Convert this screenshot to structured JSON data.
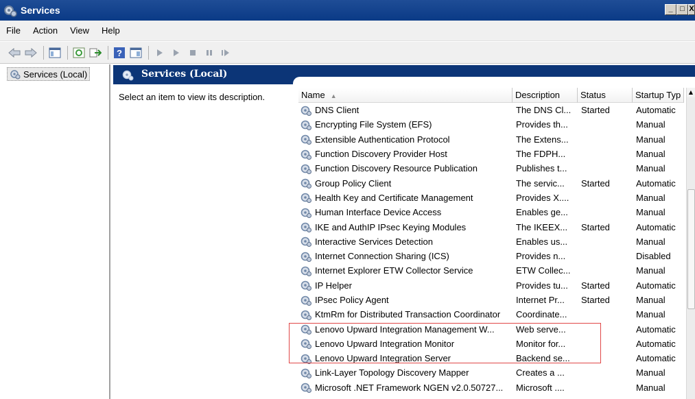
{
  "window": {
    "title": "Services"
  },
  "menu": {
    "items": [
      "File",
      "Action",
      "View",
      "Help"
    ]
  },
  "toolbar": {
    "icons": [
      "back-icon",
      "forward-icon",
      "console-tree-icon",
      "refresh-icon",
      "export-icon",
      "help-icon",
      "properties-icon",
      "start-service-icon",
      "start-icon-2",
      "stop-service-icon",
      "pause-service-icon",
      "restart-service-icon"
    ]
  },
  "tree": {
    "root_label": "Services (Local)"
  },
  "pane": {
    "header_title": "Services (Local)",
    "description_prompt": "Select an item to view its description."
  },
  "columns": {
    "name": "Name",
    "description": "Description",
    "status": "Status",
    "startup": "Startup Typ"
  },
  "services": [
    {
      "name": "DNS Client",
      "description": "The DNS Cl...",
      "status": "Started",
      "startup": "Automatic"
    },
    {
      "name": "Encrypting File System (EFS)",
      "description": "Provides th...",
      "status": "",
      "startup": "Manual"
    },
    {
      "name": "Extensible Authentication Protocol",
      "description": "The Extens...",
      "status": "",
      "startup": "Manual"
    },
    {
      "name": "Function Discovery Provider Host",
      "description": "The FDPH...",
      "status": "",
      "startup": "Manual"
    },
    {
      "name": "Function Discovery Resource Publication",
      "description": "Publishes t...",
      "status": "",
      "startup": "Manual"
    },
    {
      "name": "Group Policy Client",
      "description": "The servic...",
      "status": "Started",
      "startup": "Automatic"
    },
    {
      "name": "Health Key and Certificate Management",
      "description": "Provides X....",
      "status": "",
      "startup": "Manual"
    },
    {
      "name": "Human Interface Device Access",
      "description": "Enables ge...",
      "status": "",
      "startup": "Manual"
    },
    {
      "name": "IKE and AuthIP IPsec Keying Modules",
      "description": "The IKEEX...",
      "status": "Started",
      "startup": "Automatic"
    },
    {
      "name": "Interactive Services Detection",
      "description": "Enables us...",
      "status": "",
      "startup": "Manual"
    },
    {
      "name": "Internet Connection Sharing (ICS)",
      "description": "Provides n...",
      "status": "",
      "startup": "Disabled"
    },
    {
      "name": "Internet Explorer ETW Collector Service",
      "description": "ETW Collec...",
      "status": "",
      "startup": "Manual"
    },
    {
      "name": "IP Helper",
      "description": "Provides tu...",
      "status": "Started",
      "startup": "Automatic"
    },
    {
      "name": "IPsec Policy Agent",
      "description": "Internet Pr...",
      "status": "Started",
      "startup": "Manual"
    },
    {
      "name": "KtmRm for Distributed Transaction Coordinator",
      "description": "Coordinate...",
      "status": "",
      "startup": "Manual"
    },
    {
      "name": "Lenovo Upward Integration Management W...",
      "description": "Web serve...",
      "status": "",
      "startup": "Automatic"
    },
    {
      "name": "Lenovo Upward Integration Monitor",
      "description": "Monitor for...",
      "status": "",
      "startup": "Automatic"
    },
    {
      "name": "Lenovo Upward Integration Server",
      "description": "Backend se...",
      "status": "",
      "startup": "Automatic"
    },
    {
      "name": "Link-Layer Topology Discovery Mapper",
      "description": "Creates a ...",
      "status": "",
      "startup": "Manual"
    },
    {
      "name": "Microsoft .NET Framework NGEN v2.0.50727...",
      "description": "Microsoft ....",
      "status": "",
      "startup": "Manual"
    }
  ],
  "colors": {
    "titlebar": "#0a3a86",
    "header_band": "#0c3577",
    "highlight": "#e04646"
  }
}
